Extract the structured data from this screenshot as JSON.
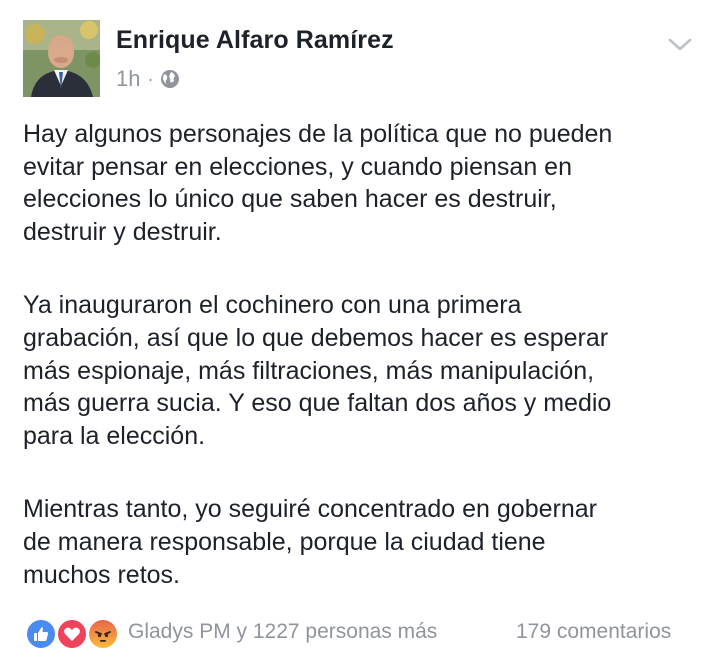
{
  "post": {
    "author": "Enrique Alfaro Ramírez",
    "time": "1h",
    "separator": "·",
    "privacy_icon": "globe-icon",
    "menu_icon": "chevron-down-icon",
    "paragraphs": [
      "Hay algunos personajes de la política que no pueden\nevitar pensar en elecciones, y cuando piensan en\nelecciones lo único que saben hacer es destruir,\ndestruir y destruir.",
      "Ya inauguraron el cochinero con una primera\ngrabación, así que lo que debemos hacer es esperar\nmás espionaje, más filtraciones, más manipulación,\nmás guerra sucia. Y eso que faltan dos años y medio\npara la elección.",
      "Mientras tanto, yo seguiré concentrado en gobernar\nde manera responsable, porque la ciudad tiene\nmuchos retos."
    ]
  },
  "footer": {
    "reaction_icons": [
      "like-icon",
      "love-icon",
      "angry-icon"
    ],
    "likes_text": "Gladys PM y 1227 personas más",
    "comments_text": "179 comentarios"
  },
  "colors": {
    "text": "#1d2129",
    "meta": "#90949c",
    "like": "#4a8bf0",
    "love": "#f0435b",
    "angry": "#f7b83b"
  }
}
